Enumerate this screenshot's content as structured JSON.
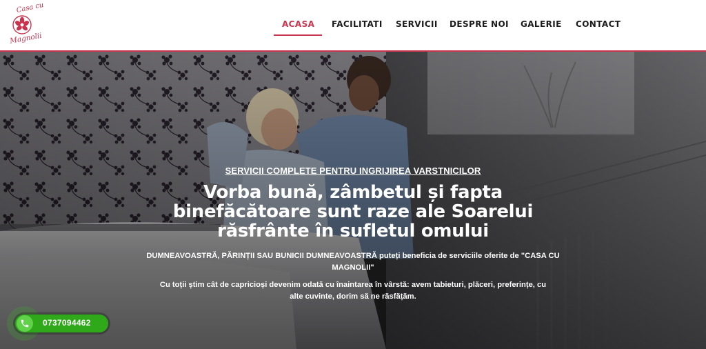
{
  "brand": {
    "logo_text_top": "Casa cu",
    "logo_text_bottom": "Magnolii",
    "logo_color": "#c9334e"
  },
  "nav": {
    "items": [
      {
        "label": "ACASA",
        "active": true
      },
      {
        "label": "FACILITATI",
        "active": false
      },
      {
        "label": "SERVICII",
        "active": false
      },
      {
        "label": "DESPRE NOI",
        "active": false
      },
      {
        "label": "GALERIE",
        "active": false
      },
      {
        "label": "CONTACT",
        "active": false
      }
    ],
    "accent_color": "#c9334e"
  },
  "hero": {
    "tagline": "SERVICII COMPLETE PENTRU INGRIJIREA VARSTNICILOR",
    "title_lines": [
      "Vorba bună, zâmbetul și fapta",
      "binefăcătoare sunt raze ale Soarelui",
      "răsfrânte în sufletul omului"
    ],
    "paragraph1_lines": [
      "DUMNEAVOASTRĂ, PĂRINȚII SAU BUNICII DUMNEAVOASTRĂ puteți beneficia de serviciile oferite de \"CASA CU",
      "MAGNOLII\""
    ],
    "paragraph2_lines": [
      "Cu toții știm cât de capricioși devenim odată cu înaintarea în vârstă: avem tabieturi, plăceri, preferințe, cu",
      "alte cuvinte, dorim să ne răsfățăm."
    ]
  },
  "contact": {
    "phone": "0737094462",
    "icon": "phone-icon",
    "button_color": "#2fa81a"
  }
}
